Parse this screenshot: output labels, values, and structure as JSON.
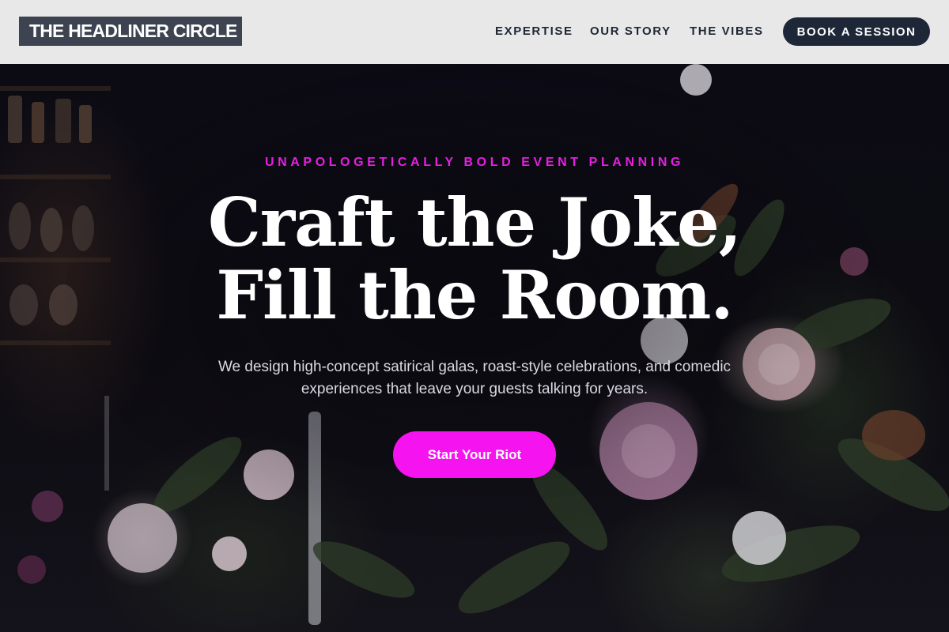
{
  "brand": {
    "name": "THE HEADLINER CIRCLE"
  },
  "nav": {
    "items": [
      {
        "label": "EXPERTISE"
      },
      {
        "label": "OUR STORY"
      },
      {
        "label": "THE VIBES"
      }
    ],
    "cta_label": "BOOK A SESSION"
  },
  "hero": {
    "kicker": "UNAPOLOGETICALLY BOLD EVENT PLANNING",
    "headline_line1": "Craft the Joke,",
    "headline_line2": "Fill the Room.",
    "subhead": "We design high-concept satirical galas, roast-style celebrations, and comedic experiences that leave your guests talking for years.",
    "cta_label": "Start Your Riot"
  },
  "colors": {
    "header_bg": "#e8e8e9",
    "logo_bg": "#3d4350",
    "nav_text": "#1f2735",
    "nav_cta_bg": "#1e2738",
    "accent_magenta": "#f514f0",
    "kicker": "#e91ee3",
    "hero_bg": "#0c0b14"
  }
}
